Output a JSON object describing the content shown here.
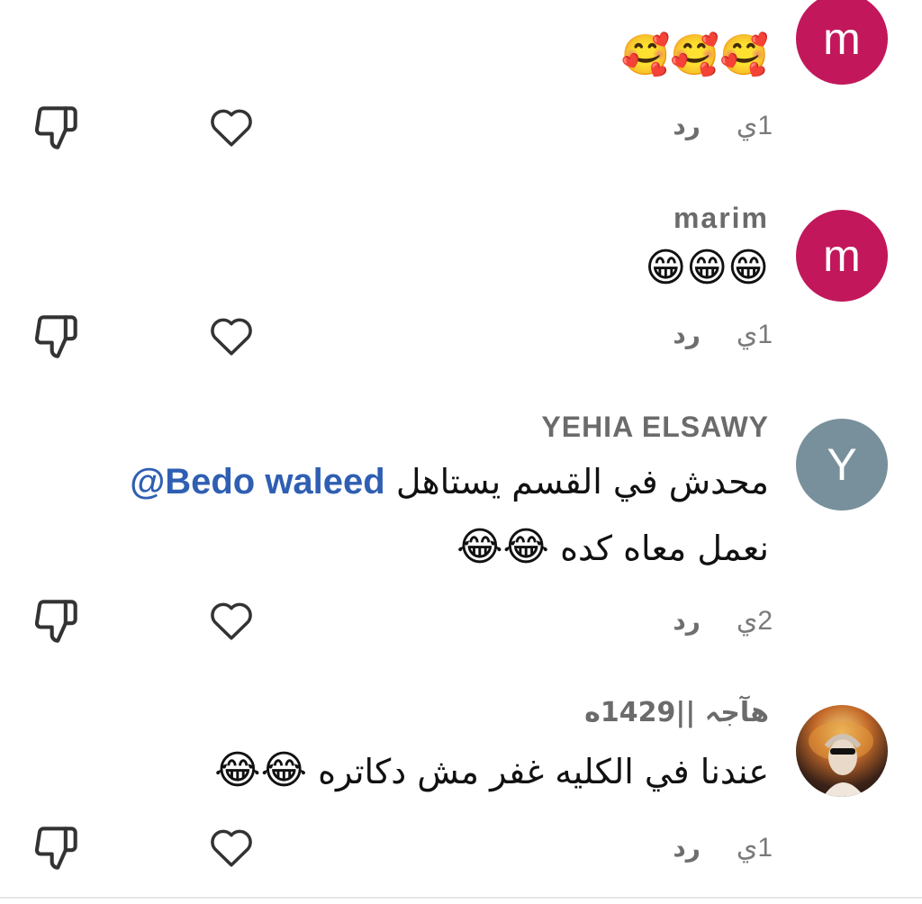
{
  "comments": [
    {
      "avatar_letter": "m",
      "avatar_color": "#c2185b",
      "name": "",
      "text": "",
      "emojis": "🥰🥰🥰",
      "time": "1ي",
      "reply": "رد"
    },
    {
      "avatar_letter": "m",
      "avatar_color": "#c2185b",
      "name": "marim",
      "text": "",
      "emojis": "😁😁😁",
      "time": "1ي",
      "reply": "رد"
    },
    {
      "avatar_letter": "Y",
      "avatar_color": "#78909c",
      "name": "YEHIA ELSAWY",
      "text_line1": "محدش في القسم يستاهل",
      "mention": "@Bedo waleed",
      "text_line2": "نعمل معاه كده",
      "emojis": "😂😂",
      "time": "2ي",
      "reply": "رد"
    },
    {
      "avatar_letter": "",
      "avatar_color": "#3a2218",
      "name": "هآجہ ||1429ه",
      "text": "عندنا في الكليه غفر مش دكاتره",
      "emojis": "😂😂",
      "time": "1ي",
      "reply": "رد"
    }
  ],
  "icons": {
    "dislike": "thumbs-down-icon",
    "like": "heart-icon"
  },
  "colors": {
    "mention": "#2f5fb3",
    "name": "#6b6b6b",
    "meta": "#7a7a7a"
  }
}
